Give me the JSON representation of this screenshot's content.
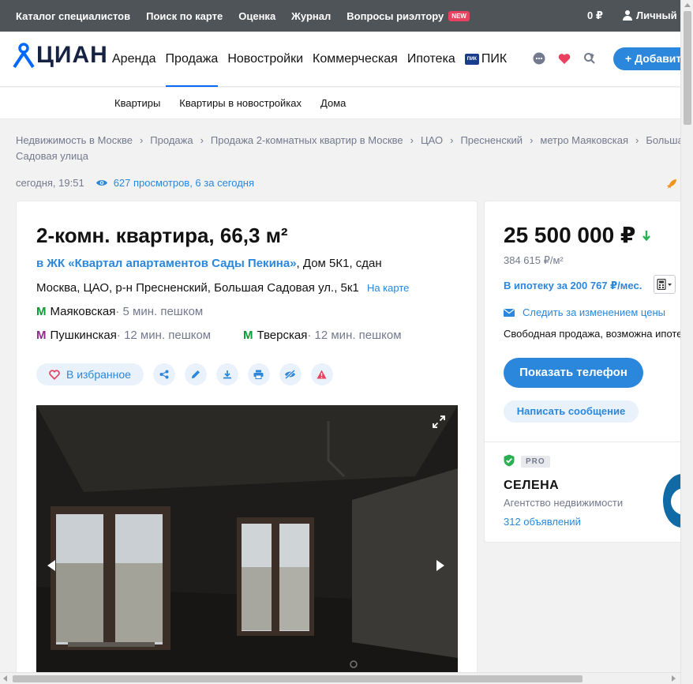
{
  "topbar": {
    "links": [
      "Каталог специалистов",
      "Поиск по карте",
      "Оценка",
      "Журнал",
      "Вопросы риэлтору"
    ],
    "new_badge": "NEW",
    "balance": "0 ₽",
    "account": "Личный кабинет"
  },
  "header": {
    "logo": "ЦИАН",
    "nav": [
      "Аренда",
      "Продажа",
      "Новостройки",
      "Коммерческая",
      "Ипотека"
    ],
    "pik_logo": "ПИК",
    "pik": "ПИК",
    "add_button": "+ Добавить"
  },
  "subnav": [
    "Квартиры",
    "Квартиры в новостройках",
    "Дома"
  ],
  "breadcrumbs": {
    "row1": [
      "Недвижимость в Москве",
      "Продажа",
      "Продажа 2-комнатных квартир в Москве",
      "ЦАО",
      "Пресненский",
      "метро Маяковская",
      "Большая"
    ],
    "row2": "Садовая улица"
  },
  "meta": {
    "date": "сегодня, 19:51",
    "views": "627 просмотров, 6 за сегодня"
  },
  "listing": {
    "title": "2-комн. квартира, 66,3 м²",
    "complex_link": "в ЖК «Квартал апартаментов Сады Пекина»",
    "complex_rest": ", Дом 5К1, сдан",
    "address": "Москва, ЦАО, р-н Пресненский, Большая Садовая ул., 5к1",
    "map_link": "На карте",
    "metro": [
      {
        "name": "Маяковская",
        "distance": " · 5 мин. пешком",
        "color": "#0a9b34"
      },
      {
        "name": "Пушкинская",
        "distance": " · 12 мин. пешком",
        "color": "#8f2a8f"
      },
      {
        "name": "Тверская",
        "distance": " · 12 мин. пешком",
        "color": "#0a9b34"
      }
    ],
    "favorite": "В избранное",
    "metro_letter": "М"
  },
  "offer": {
    "price": "25 500 000 ₽",
    "price_per_m2": "384 615 ₽/м²",
    "mortgage": "В ипотеку за 200 767 ₽/мес.",
    "track": "Следить за изменением цены",
    "sale_type": "Свободная продажа, возможна ипотека",
    "show_phone": "Показать телефон",
    "write_message": "Написать сообщение",
    "pro": "PRO",
    "agent_name": "СЕЛЕНА",
    "agent_type": "Агентство недвижимости",
    "agent_ads": "312 объявлений"
  },
  "colors": {
    "accent": "#2b87db",
    "topbar": "#4f5458",
    "favorite_heart": "#e84260"
  }
}
